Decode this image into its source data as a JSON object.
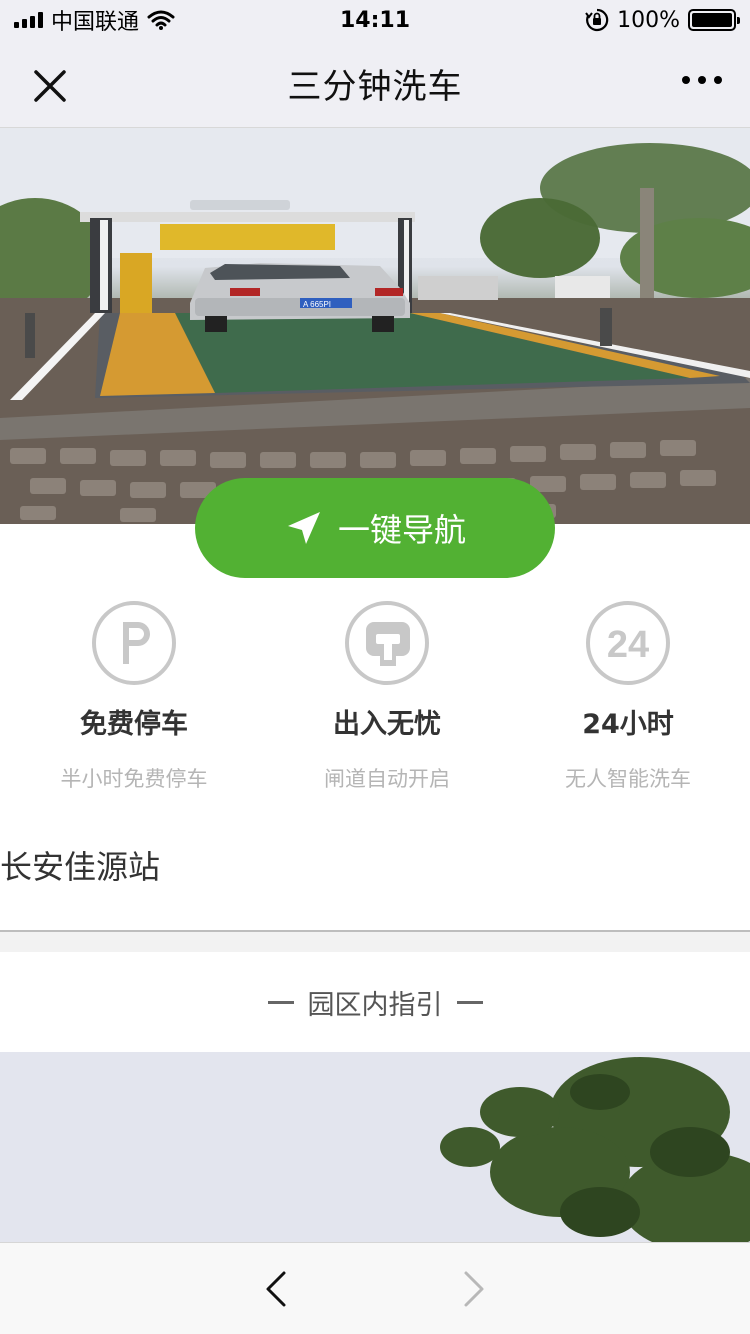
{
  "status_bar": {
    "carrier": "中国联通",
    "time": "14:11",
    "battery": "100%"
  },
  "nav": {
    "title": "三分钟洗车"
  },
  "hero": {
    "plate": "A 665PI"
  },
  "navigate_button": {
    "label": "一键导航"
  },
  "features": [
    {
      "icon": "parking-icon",
      "title": "免费停车",
      "subtitle": "半小时免费停车"
    },
    {
      "icon": "gate-icon",
      "title": "出入无忧",
      "subtitle": "闸道自动开启"
    },
    {
      "icon": "24-hours-icon",
      "icon_text": "24",
      "title": "24小时",
      "subtitle": "无人智能洗车"
    }
  ],
  "station": {
    "name": "长安佳源站"
  },
  "guide": {
    "heading": "园区内指引"
  },
  "colors": {
    "accent_green": "#52b133",
    "icon_gray": "#c8c8c8"
  }
}
